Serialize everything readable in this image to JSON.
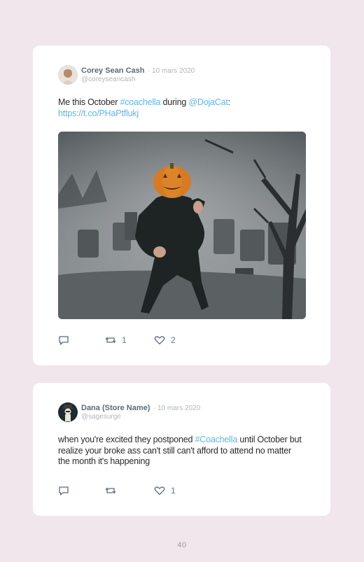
{
  "tweets": [
    {
      "author": "Corey Sean Cash",
      "date": "· 10 mars 2020",
      "handle": "@coreyseancash",
      "text_parts": {
        "a": "Me this October ",
        "b": "#coachella",
        "c": " during ",
        "d": "@DojaCat",
        "e": ":",
        "f": "https://t.co/PHaPtflukj"
      },
      "retweets": "1",
      "likes": "2"
    },
    {
      "author": "Dana (Store Name)",
      "date": "· 10 mars 2020",
      "handle": "@sagesurge",
      "text_parts": {
        "a": "when you're excited they postponed ",
        "b": "#Coachella",
        "c": " until October but realize your broke ass can't still can't afford to attend no matter the month it's happening"
      },
      "retweets": "",
      "likes": "1"
    }
  ],
  "page_number": "40",
  "colors": {
    "link": "#5fb6e6",
    "background": "#f1e6ec",
    "card": "#ffffff"
  },
  "icons": [
    "reply-icon",
    "retweet-icon",
    "heart-icon"
  ]
}
